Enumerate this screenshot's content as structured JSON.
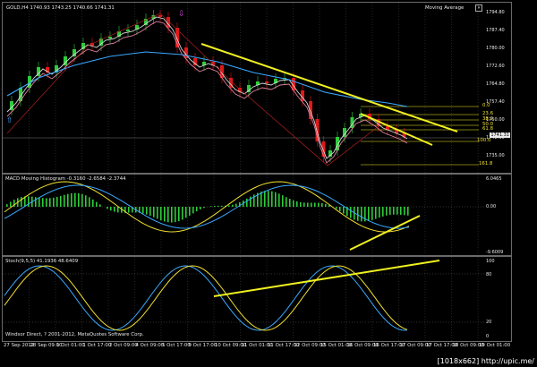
{
  "header": {
    "symbol_ohlc": "GOLD,H4  1740.93  1743.25  1740.66  1741.31",
    "indicator_label": "Moving Average"
  },
  "price_axis": [
    "1794.80",
    "1787.40",
    "1780.00",
    "1772.60",
    "1764.80",
    "1757.40",
    "1750.00",
    "1742.60",
    "1735.00"
  ],
  "price_current": "1741.31",
  "fib_labels": [
    "0.0",
    "23.6",
    "38.2",
    "50.0",
    "61.8",
    "100.0",
    "161.8"
  ],
  "macd": {
    "label": "MACD Moving Histogram -0.3160 -2.6584 -2.3744",
    "axis": [
      "6.0465",
      "0.00",
      "-9.6009"
    ]
  },
  "stoch": {
    "label": "Stoch(9,5,5) 41.1936 48.6409",
    "axis": [
      "100",
      "80",
      "20",
      "0"
    ]
  },
  "footer": "Windsor Direct, ? 2001-2012, MetaQuotes Software Corp.",
  "time_axis": [
    "27 Sep 2012",
    "28 Sep 09:00",
    "1 Oct 01:00",
    "1 Oct 17:00",
    "2 Oct 09:00",
    "4 Oct 09:00",
    "5 Oct 17:00",
    "9 Oct 17:00",
    "10 Oct 09:00",
    "11 Oct 01:00",
    "11 Oct 17:00",
    "12 Oct 09:00",
    "15 Oct 01:00",
    "16 Oct 09:00",
    "16 Oct 17:00",
    "17 Oct 09:00",
    "17 Oct 17:00",
    "18 Oct 09:00",
    "19 Oct 01:00"
  ],
  "watermark": "[1018x662] http://upic.me/",
  "colors": {
    "bull_candle": "#2ecc3a",
    "bear_candle": "#e01818",
    "ma_fast": "#d8d8d8",
    "ma_mid": "#e080a0",
    "ma_slow": "#3aa8ff",
    "trendline": "#f0f020",
    "macd_hist": "#2ecc3a",
    "macd_signal": "#f0e030",
    "macd_line": "#3aa8ff",
    "stoch_main": "#3aa8ff",
    "stoch_signal": "#f0e030",
    "grid": "#5a5a5a"
  },
  "icons": [
    "arrow-up-icon",
    "arrow-down-icon",
    "chart-menu-icon"
  ]
}
